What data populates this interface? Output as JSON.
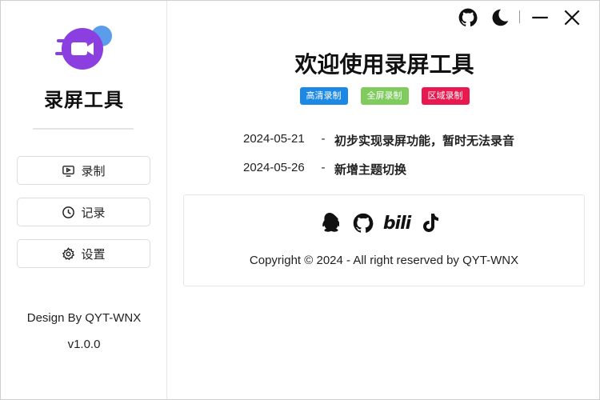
{
  "app": {
    "name": "录屏工具",
    "design_by": "Design By QYT-WNX",
    "version": "v1.0.0"
  },
  "nav": [
    {
      "label": "录制",
      "icon": "screen-record-icon"
    },
    {
      "label": "记录",
      "icon": "clock-icon"
    },
    {
      "label": "设置",
      "icon": "gear-icon"
    }
  ],
  "topbar": {
    "icons": [
      "github-icon",
      "moon-icon",
      "minimize-icon",
      "close-icon"
    ]
  },
  "main": {
    "title": "欢迎使用录屏工具",
    "tags": [
      {
        "label": "高清录制",
        "color": "#1e88e5"
      },
      {
        "label": "全屏录制",
        "color": "#7fcb5e"
      },
      {
        "label": "区域录制",
        "color": "#e8194f"
      }
    ],
    "changelog": [
      {
        "date": "2024-05-21",
        "sep": "-",
        "text": "初步实现录屏功能，暂时无法录音"
      },
      {
        "date": "2024-05-26",
        "sep": "-",
        "text": "新增主题切换"
      }
    ],
    "footer": {
      "social_icons": [
        "qq-icon",
        "github-icon",
        "bilibili-icon",
        "tiktok-icon"
      ],
      "bili_text": "bili",
      "copyright": "Copyright © 2024 - All right reserved by QYT-WNX"
    }
  },
  "colors": {
    "logo_purple": "#8b3fe0",
    "logo_blue": "#5b9dea"
  }
}
